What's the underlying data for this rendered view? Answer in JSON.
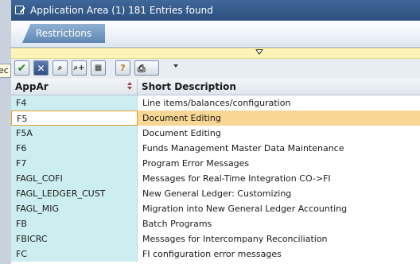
{
  "background_window": {
    "field_fragment": "ec"
  },
  "dialog": {
    "title": "Application Area (1)  181 Entries found",
    "tabs": [
      {
        "label": "Restrictions",
        "active": true
      }
    ],
    "toolbar": {
      "buttons": [
        {
          "icon": "checkmark-icon",
          "glyph": "✔"
        },
        {
          "icon": "cancel-icon",
          "glyph": "✕"
        },
        {
          "icon": "find-icon",
          "glyph": "⌕"
        },
        {
          "icon": "find-next-icon",
          "glyph": "⌕+"
        },
        {
          "icon": "select-icon",
          "glyph": "▦"
        },
        {
          "icon": "info-icon",
          "glyph": "?"
        },
        {
          "icon": "print-icon",
          "glyph": "⎙"
        }
      ]
    },
    "table": {
      "columns": [
        "AppAr",
        "Short Description"
      ],
      "rows": [
        {
          "code": "F4",
          "description": "Line items/balances/configuration"
        },
        {
          "code": "F5",
          "description": "Document Editing",
          "selected": true
        },
        {
          "code": "F5A",
          "description": "Document Editing"
        },
        {
          "code": "F6",
          "description": "Funds Management Master Data Maintenance"
        },
        {
          "code": "F7",
          "description": "Program Error Messages"
        },
        {
          "code": "FAGL_COFI",
          "description": "Messages for Real-Time Integration CO->FI"
        },
        {
          "code": "FAGL_LEDGER_CUST",
          "description": "New General Ledger: Customizing"
        },
        {
          "code": "FAGL_MIG",
          "description": "Migration into New General Ledger Accounting"
        },
        {
          "code": "FB",
          "description": "Batch Programs"
        },
        {
          "code": "FBICRC",
          "description": "Messages for Intercompany Reconciliation"
        },
        {
          "code": "FC",
          "description": "FI configuration error messages"
        }
      ]
    }
  },
  "colors": {
    "title_bar": "#2d5180",
    "key_column": "#cdeef0",
    "selected_row": "#f8d794",
    "selection_border": "#e49d2b",
    "collapse_bar": "#fff4b8"
  }
}
